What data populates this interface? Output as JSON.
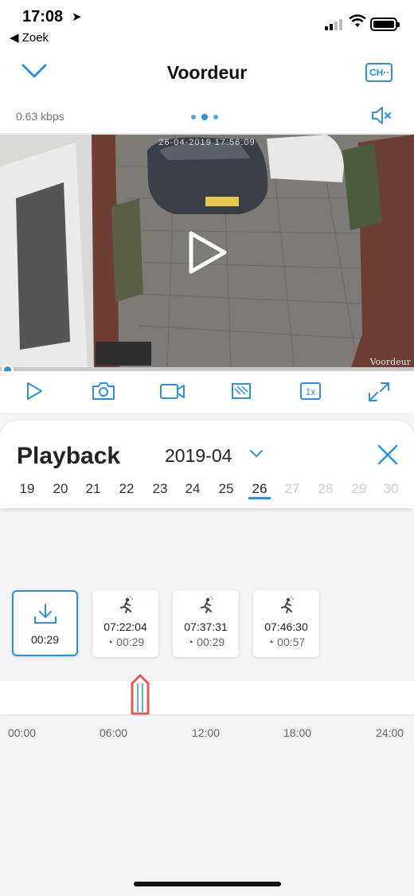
{
  "status_bar": {
    "time": "17:08",
    "back_label": "◀ Zoek"
  },
  "header": {
    "title": "Voordeur",
    "channel_label": "CH··",
    "bitrate": "0.63 kbps"
  },
  "video": {
    "timestamp": "26-04-2019 17:56:09",
    "camera_label": "Voordeur",
    "progress": 0.0
  },
  "toolbar": {
    "items": [
      "play-icon",
      "camera-icon",
      "record-icon",
      "quality-icon",
      "speed-1x-icon",
      "fullscreen-icon"
    ],
    "speed_label": "1x"
  },
  "playback": {
    "title": "Playback",
    "month": "2019-04",
    "days": [
      "19",
      "20",
      "21",
      "22",
      "23",
      "24",
      "25",
      "26",
      "27",
      "28",
      "29",
      "30"
    ],
    "selected_day": "26"
  },
  "clips": [
    {
      "type": "download",
      "duration": "00:29"
    },
    {
      "type": "motion",
      "time": "07:22:04",
      "duration": "00:29"
    },
    {
      "type": "motion",
      "time": "07:37:31",
      "duration": "00:29"
    },
    {
      "type": "motion",
      "time": "07:46:30",
      "duration": "00:57"
    }
  ],
  "timeline": {
    "ticks": [
      "00:00",
      "06:00",
      "12:00",
      "18:00",
      "24:00"
    ],
    "cursor_time": "07:22"
  },
  "colors": {
    "accent": "#2d8fe0",
    "marker": "#e05a5a"
  }
}
